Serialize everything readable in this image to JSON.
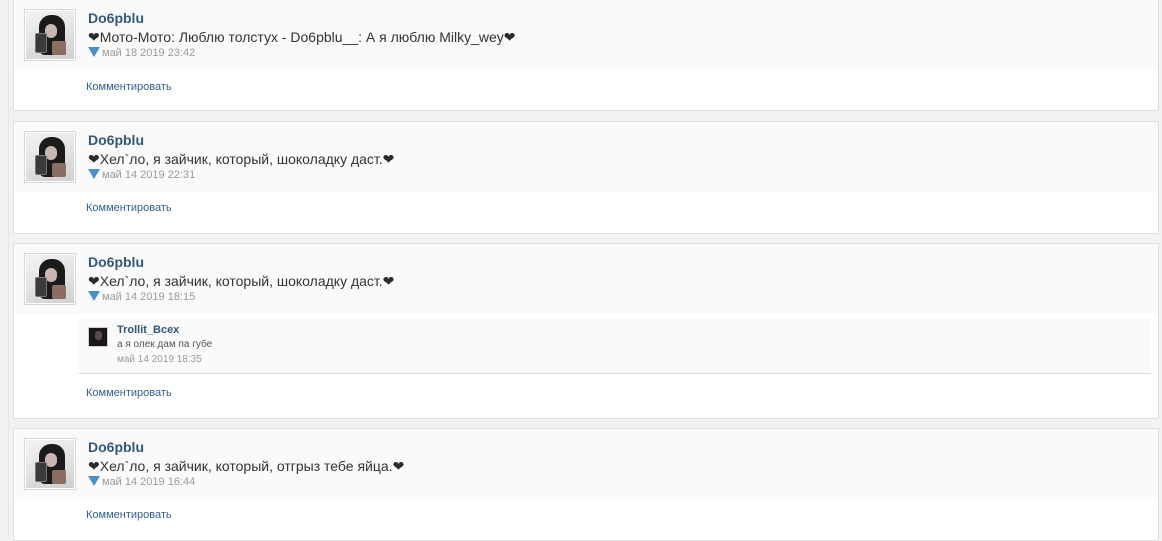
{
  "posts": [
    {
      "author": "Do6pblu",
      "text": "Мото-Мото: Люблю толстух - Do6pblu__: А я люблю Milky_wey",
      "time": "май 18 2019 23:42",
      "comment_label": "Комментировать",
      "replies": []
    },
    {
      "author": "Do6pblu",
      "text": "Хел`ло, я зайчик, который, шоколадку даст.",
      "time": "май 14 2019 22:31",
      "comment_label": "Комментировать",
      "replies": []
    },
    {
      "author": "Do6pblu",
      "text": "Хел`ло, я зайчик, который, шоколадку даст.",
      "time": "май 14 2019 18:15",
      "comment_label": "Комментировать",
      "replies": [
        {
          "author": "Trollit_Всех",
          "text": "а я олек дам па губе",
          "time": "май 14 2019 18:35"
        }
      ]
    },
    {
      "author": "Do6pblu",
      "text": "Хел`ло, я зайчик, который, отгрыз тебе яйца.",
      "time": "май 14 2019 16:44",
      "comment_label": "Комментировать",
      "replies": []
    }
  ],
  "icons": {
    "heart": "heart-icon",
    "time_marker": "triangle-marker-icon"
  },
  "colors": {
    "username": "#33577a",
    "link": "#2f5f8f",
    "marker": "#4a8fc7"
  }
}
